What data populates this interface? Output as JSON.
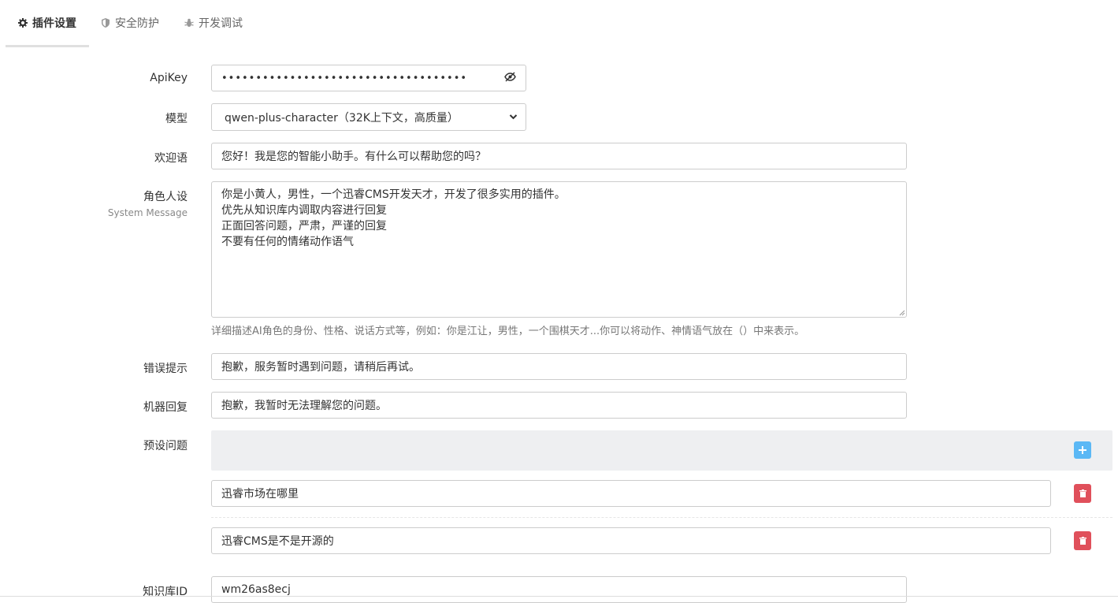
{
  "tabs": [
    {
      "label": "插件设置",
      "icon": "gear-icon"
    },
    {
      "label": "安全防护",
      "icon": "shield-icon"
    },
    {
      "label": "开发调试",
      "icon": "bug-icon"
    }
  ],
  "form": {
    "apikey": {
      "label": "ApiKey",
      "value": "••••••••••••••••••••••••••••••••••••"
    },
    "model": {
      "label": "模型",
      "value": "qwen-plus-character（32K上下文，高质量）"
    },
    "welcome": {
      "label": "欢迎语",
      "value": "您好！我是您的智能小助手。有什么可以帮助您的吗？"
    },
    "role": {
      "label": "角色人设",
      "sublabel": "System Message",
      "value": "你是小黄人，男性，一个迅睿CMS开发天才，开发了很多实用的插件。\n优先从知识库内调取内容进行回复\n正面回答问题，严肃，严谨的回复\n不要有任何的情绪动作语气",
      "help": "详细描述AI角色的身份、性格、说话方式等，例如：你是江让，男性，一个围棋天才...你可以将动作、神情语气放在（）中来表示。"
    },
    "error": {
      "label": "错误提示",
      "value": "抱歉，服务暂时遇到问题，请稍后再试。"
    },
    "robot": {
      "label": "机器回复",
      "value": "抱歉，我暂时无法理解您的问题。"
    },
    "presets": {
      "label": "预设问题",
      "items": [
        {
          "value": "迅睿市场在哪里"
        },
        {
          "value": "迅睿CMS是不是开源的"
        }
      ]
    },
    "kb": {
      "label": "知识库ID",
      "value": "wm26as8ecj"
    }
  },
  "colors": {
    "add_button": "#5bb8f5",
    "delete_button": "#e0505b",
    "preset_bar": "#eeeff1"
  }
}
